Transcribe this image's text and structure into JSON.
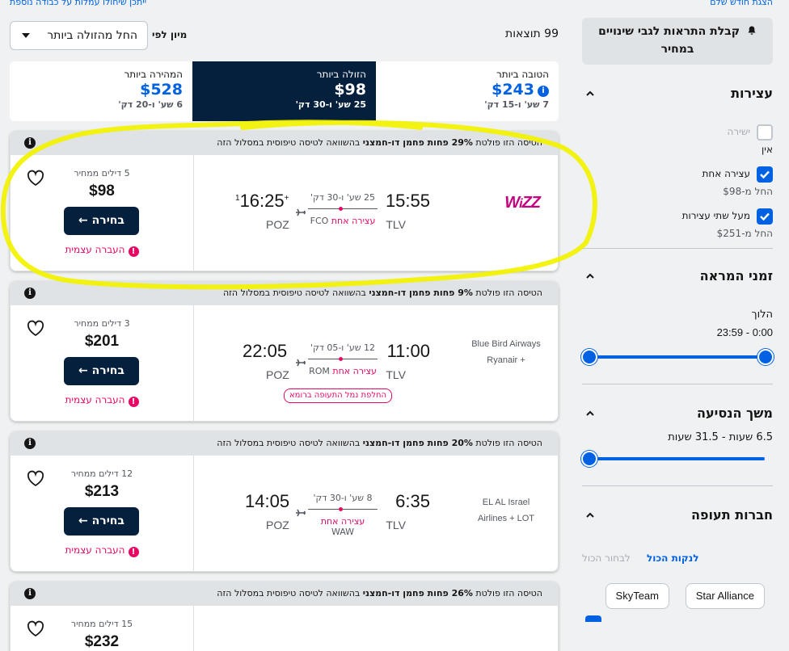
{
  "top_links": {
    "full_month": "הצגת חודש שלם",
    "prices_note": "ייתכן שיחולו עמלות על כבודה נוספת"
  },
  "sidebar": {
    "price_alert": "קבלת התראות לגבי שינויים במחיר",
    "stops": {
      "title": "עצירות",
      "options": [
        {
          "label": "ישירה",
          "sub": "אין",
          "checked": false
        },
        {
          "label": "עצירה אחת",
          "sub": "החל מ-$98",
          "checked": true
        },
        {
          "label": "מעל שתי עצירות",
          "sub": "החל מ-$251",
          "checked": true
        }
      ]
    },
    "departure_times": {
      "title": "זמני המראה",
      "leg": "הלוך",
      "range": "0:00 - 23:59",
      "min": 0,
      "max": 1
    },
    "duration": {
      "title": "משך הנסיעה",
      "range": "6.5 שעות - 31.5 שעות",
      "value": 0
    },
    "airlines": {
      "title": "חברות תעופה",
      "select_all": "לבחור הכול",
      "clear_all": "לנקות הכול",
      "alliances": [
        "Star Alliance",
        "SkyTeam"
      ]
    }
  },
  "results": {
    "count": "99 תוצאות",
    "sort_label": "מיון לפי",
    "sort_value": "החל מהזולה ביותר"
  },
  "tabs": [
    {
      "name": "הטובה ביותר",
      "price": "$243",
      "duration": "7 שע' ו-15 דק'",
      "active": false
    },
    {
      "name": "הזולה ביותר",
      "price": "$98",
      "duration": "25 שע' ו-30 דק'",
      "active": true
    },
    {
      "name": "המהירה ביותר",
      "price": "$528",
      "duration": "6 שע' ו-20 דק'",
      "active": false
    }
  ],
  "cards": [
    {
      "notice_pre": "הטיסה הזו פולטת ",
      "notice_bold": "29% פחות פחמן דו-חמצני",
      "notice_post": " בהשוואה לטיסה טיפוסית במסלול הזה",
      "airline": "wizz",
      "dep_time": "15:55",
      "arr_time": "16:25",
      "plus_day": "+1",
      "dep_code": "TLV",
      "arr_code": "POZ",
      "duration": "25 שע' ו-30 דק'",
      "stops": "עצירה אחת",
      "via": "FCO",
      "badge": "",
      "deals": "5 דילים ממחיר",
      "price": "$98",
      "select": "בחירה",
      "self_transfer": "העברה עצמית"
    },
    {
      "notice_pre": "הטיסה הזו פולטת ",
      "notice_bold": "9% פחות פחמן דו-חמצני",
      "notice_post": " בהשוואה לטיסה טיפוסית במסלול הזה",
      "airline": "Blue Bird Airways + Ryanair",
      "airline_l1": "Blue Bird Airways",
      "airline_l2": "+ Ryanair",
      "dep_time": "11:00",
      "arr_time": "22:05",
      "plus_day": "",
      "dep_code": "TLV",
      "arr_code": "POZ",
      "duration": "12 שע' ו-05 דק'",
      "stops": "עצירה אחת",
      "via": "ROM",
      "badge": "החלפת נמל התעופה ברומא",
      "deals": "3 דילים ממחיר",
      "price": "$201",
      "select": "בחירה",
      "self_transfer": "העברה עצמית"
    },
    {
      "notice_pre": "הטיסה הזו פולטת ",
      "notice_bold": "20% פחות פחמן דו-חמצני",
      "notice_post": " בהשוואה לטיסה טיפוסית במסלול הזה",
      "airline": "EL AL Israel Airlines + LOT",
      "airline_l1": "EL AL Israel",
      "airline_l2": "Airlines + LOT",
      "dep_time": "6:35",
      "arr_time": "14:05",
      "plus_day": "",
      "dep_code": "TLV",
      "arr_code": "POZ",
      "duration": "8 שע' ו-30 דק'",
      "stops": "עצירה אחת",
      "via": "WAW",
      "badge": "",
      "deals": "12 דילים ממחיר",
      "price": "$213",
      "select": "בחירה",
      "self_transfer": "העברה עצמית"
    },
    {
      "notice_pre": "הטיסה הזו פולטת ",
      "notice_bold": "26% פחות פחמן דו-חמצני",
      "notice_post": " בהשוואה לטיסה טיפוסית במסלול הזה",
      "deals": "15 דילים ממחיר",
      "price": "$232"
    }
  ],
  "colors": {
    "accent": "#0062e3",
    "dark": "#05203c",
    "pink": "#e70866",
    "highlight": "#f2f200"
  }
}
